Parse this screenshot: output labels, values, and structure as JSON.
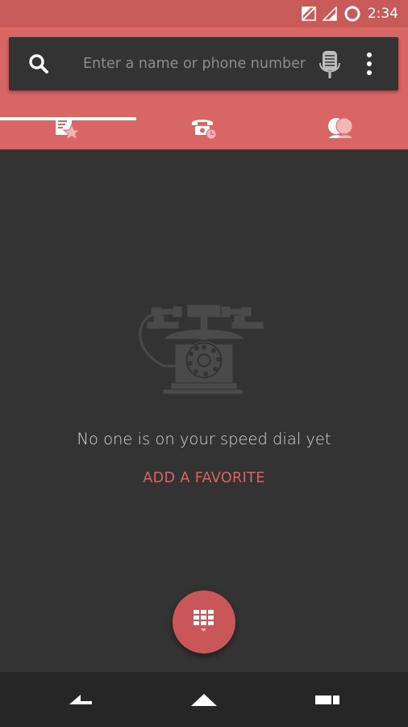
{
  "status_bar": {
    "time": "2:34",
    "icons": [
      "no-sim-icon",
      "signal-icon",
      "ring-icon"
    ],
    "color": "#c85a5a"
  },
  "search": {
    "placeholder": "Enter a name or phone number",
    "search_icon": "search-icon",
    "mic_icon": "mic-icon",
    "overflow_icon": "more-vertical-icon"
  },
  "tabs": [
    {
      "name": "speed-dial",
      "icon": "speed-dial-star-icon",
      "selected": true
    },
    {
      "name": "recents",
      "icon": "recents-phone-clock-icon",
      "selected": false
    },
    {
      "name": "contacts",
      "icon": "contacts-people-icon",
      "selected": false
    }
  ],
  "empty_state": {
    "illustration": "rotary-phone-illustration",
    "message": "No one is on your speed dial yet",
    "action_label": "ADD A FAVORITE"
  },
  "fab": {
    "icon": "dialpad-icon"
  },
  "nav": {
    "back": "back-icon",
    "home": "home-icon",
    "recents": "recent-apps-icon"
  },
  "colors": {
    "accent": "#d86664",
    "header": "#d86664",
    "status": "#c85a5a",
    "background": "#333333",
    "fab": "#c9575a",
    "nav": "#262626"
  }
}
